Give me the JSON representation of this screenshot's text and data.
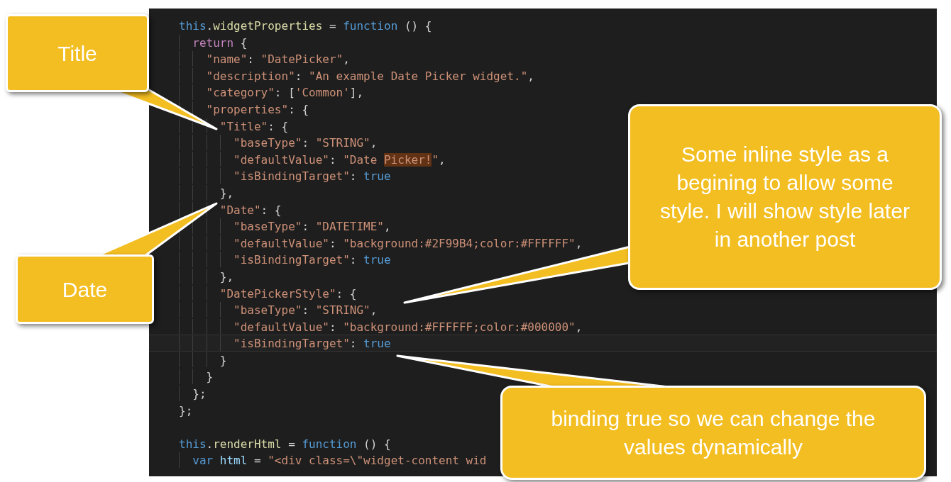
{
  "editor": {
    "lines": [
      {
        "kind": "code",
        "current": false,
        "tokens": [
          {
            "kind": "kw",
            "text": "this"
          },
          {
            "kind": "p",
            "text": "."
          },
          {
            "kind": "fn",
            "text": "widgetProperties"
          },
          {
            "kind": "p",
            "text": " = "
          },
          {
            "kind": "kw",
            "text": "function"
          },
          {
            "kind": "p",
            "text": " () {"
          }
        ]
      },
      {
        "kind": "code",
        "current": false,
        "tokens": [
          {
            "kind": "ctrl",
            "text": "  return"
          },
          {
            "kind": "p",
            "text": " {"
          }
        ]
      },
      {
        "kind": "code",
        "current": false,
        "tokens": [
          {
            "kind": "str",
            "text": "    \"name\""
          },
          {
            "kind": "p",
            "text": ": "
          },
          {
            "kind": "str",
            "text": "\"DatePicker\""
          },
          {
            "kind": "p",
            "text": ","
          }
        ]
      },
      {
        "kind": "code",
        "current": false,
        "tokens": [
          {
            "kind": "str",
            "text": "    \"description\""
          },
          {
            "kind": "p",
            "text": ": "
          },
          {
            "kind": "str",
            "text": "\"An example Date Picker widget.\""
          },
          {
            "kind": "p",
            "text": ","
          }
        ]
      },
      {
        "kind": "code",
        "current": false,
        "tokens": [
          {
            "kind": "str",
            "text": "    \"category\""
          },
          {
            "kind": "p",
            "text": ": ["
          },
          {
            "kind": "str",
            "text": "'Common'"
          },
          {
            "kind": "p",
            "text": "],"
          }
        ]
      },
      {
        "kind": "code",
        "current": false,
        "tokens": [
          {
            "kind": "str",
            "text": "    \"properties\""
          },
          {
            "kind": "p",
            "text": ": {"
          }
        ]
      },
      {
        "kind": "code",
        "current": false,
        "tokens": [
          {
            "kind": "str",
            "text": "      \"Title\""
          },
          {
            "kind": "p",
            "text": ": {"
          }
        ]
      },
      {
        "kind": "code",
        "current": false,
        "tokens": [
          {
            "kind": "str",
            "text": "        \"baseType\""
          },
          {
            "kind": "p",
            "text": ": "
          },
          {
            "kind": "str",
            "text": "\"STRING\""
          },
          {
            "kind": "p",
            "text": ","
          }
        ]
      },
      {
        "kind": "code",
        "current": false,
        "tokens": [
          {
            "kind": "str",
            "text": "        \"defaultValue\""
          },
          {
            "kind": "p",
            "text": ": "
          },
          {
            "kind": "str",
            "text": "\"Date "
          },
          {
            "kind": "match",
            "text": "Picker!"
          },
          {
            "kind": "str",
            "text": "\""
          },
          {
            "kind": "p",
            "text": ","
          }
        ]
      },
      {
        "kind": "code",
        "current": false,
        "tokens": [
          {
            "kind": "str",
            "text": "        \"isBindingTarget\""
          },
          {
            "kind": "p",
            "text": ": "
          },
          {
            "kind": "kw",
            "text": "true"
          }
        ]
      },
      {
        "kind": "code",
        "current": false,
        "tokens": [
          {
            "kind": "p",
            "text": "      },"
          }
        ]
      },
      {
        "kind": "code",
        "current": false,
        "tokens": [
          {
            "kind": "str",
            "text": "      \"Date\""
          },
          {
            "kind": "p",
            "text": ": {"
          }
        ]
      },
      {
        "kind": "code",
        "current": false,
        "tokens": [
          {
            "kind": "str",
            "text": "        \"baseType\""
          },
          {
            "kind": "p",
            "text": ": "
          },
          {
            "kind": "str",
            "text": "\"DATETIME\""
          },
          {
            "kind": "p",
            "text": ","
          }
        ]
      },
      {
        "kind": "code",
        "current": false,
        "tokens": [
          {
            "kind": "str",
            "text": "        \"defaultValue\""
          },
          {
            "kind": "p",
            "text": ": "
          },
          {
            "kind": "str",
            "text": "\"background:#2F99B4;color:#FFFFFF\""
          },
          {
            "kind": "p",
            "text": ","
          }
        ]
      },
      {
        "kind": "code",
        "current": false,
        "tokens": [
          {
            "kind": "str",
            "text": "        \"isBindingTarget\""
          },
          {
            "kind": "p",
            "text": ": "
          },
          {
            "kind": "kw",
            "text": "true"
          }
        ]
      },
      {
        "kind": "code",
        "current": false,
        "tokens": [
          {
            "kind": "p",
            "text": "      },"
          }
        ]
      },
      {
        "kind": "code",
        "current": false,
        "tokens": [
          {
            "kind": "str",
            "text": "      \"DatePickerStyle\""
          },
          {
            "kind": "p",
            "text": ": {"
          }
        ]
      },
      {
        "kind": "code",
        "current": false,
        "tokens": [
          {
            "kind": "str",
            "text": "        \"baseType\""
          },
          {
            "kind": "p",
            "text": ": "
          },
          {
            "kind": "str",
            "text": "\"STRING\""
          },
          {
            "kind": "p",
            "text": ","
          }
        ]
      },
      {
        "kind": "code",
        "current": false,
        "tokens": [
          {
            "kind": "str",
            "text": "        \"defaultValue\""
          },
          {
            "kind": "p",
            "text": ": "
          },
          {
            "kind": "str",
            "text": "\"background:#FFFFFF;color:#000000\""
          },
          {
            "kind": "p",
            "text": ","
          }
        ]
      },
      {
        "kind": "code",
        "current": true,
        "tokens": [
          {
            "kind": "str",
            "text": "        \"isBindingTarget\""
          },
          {
            "kind": "p",
            "text": ": "
          },
          {
            "kind": "kw",
            "text": "true"
          }
        ]
      },
      {
        "kind": "code",
        "current": false,
        "tokens": [
          {
            "kind": "p",
            "text": "      }"
          }
        ]
      },
      {
        "kind": "code",
        "current": false,
        "tokens": [
          {
            "kind": "p",
            "text": "    }"
          }
        ]
      },
      {
        "kind": "code",
        "current": false,
        "tokens": [
          {
            "kind": "p",
            "text": "  };"
          }
        ]
      },
      {
        "kind": "code",
        "current": false,
        "tokens": [
          {
            "kind": "p",
            "text": "};"
          }
        ]
      },
      {
        "kind": "blank"
      },
      {
        "kind": "code",
        "current": false,
        "tokens": [
          {
            "kind": "kw",
            "text": "this"
          },
          {
            "kind": "p",
            "text": "."
          },
          {
            "kind": "fn",
            "text": "renderHtml"
          },
          {
            "kind": "p",
            "text": " = "
          },
          {
            "kind": "kw",
            "text": "function"
          },
          {
            "kind": "p",
            "text": " () {"
          }
        ]
      },
      {
        "kind": "code",
        "current": false,
        "tokens": [
          {
            "kind": "kw",
            "text": "  var "
          },
          {
            "kind": "var",
            "text": "html"
          },
          {
            "kind": "p",
            "text": " = "
          },
          {
            "kind": "str",
            "text": "\"<div class=\\\"widget-content wid"
          }
        ]
      }
    ]
  },
  "callouts": [
    {
      "kind": "title",
      "lines": [
        "Title"
      ]
    },
    {
      "kind": "date",
      "lines": [
        "Date"
      ]
    },
    {
      "kind": "style",
      "lines": [
        "Some inline style as a",
        "begining to allow some",
        "style. I will show style later",
        "in another post"
      ]
    },
    {
      "kind": "binding",
      "lines": [
        "binding true so we can change the",
        "values dynamically"
      ]
    }
  ]
}
